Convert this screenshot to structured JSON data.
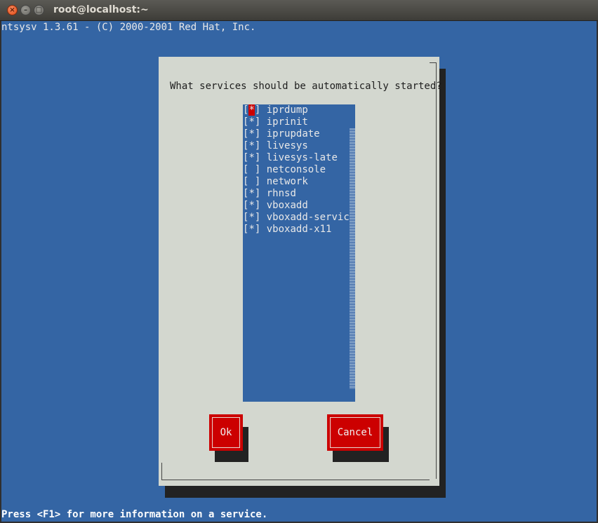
{
  "window": {
    "title": "root@localhost:~",
    "close_glyph": "×",
    "minimize_glyph": "–",
    "maximize_glyph": "□"
  },
  "terminal": {
    "header": "ntsysv 1.3.61 - (C) 2000-2001 Red Hat, Inc.",
    "footer": "Press <F1> for more information on a service."
  },
  "dialog": {
    "question": "What services should be automatically started?",
    "services": [
      {
        "name": "iprdump",
        "checked": true,
        "mark": "*"
      },
      {
        "name": "iprinit",
        "checked": true,
        "mark": "*"
      },
      {
        "name": "iprupdate",
        "checked": true,
        "mark": "*"
      },
      {
        "name": "livesys",
        "checked": true,
        "mark": "*"
      },
      {
        "name": "livesys-late",
        "checked": true,
        "mark": "*"
      },
      {
        "name": "netconsole",
        "checked": false,
        "mark": " "
      },
      {
        "name": "network",
        "checked": false,
        "mark": " "
      },
      {
        "name": "rhnsd",
        "checked": true,
        "mark": "*"
      },
      {
        "name": "vboxadd",
        "checked": true,
        "mark": "*"
      },
      {
        "name": "vboxadd-service",
        "checked": true,
        "mark": "*"
      },
      {
        "name": "vboxadd-x11",
        "checked": true,
        "mark": "*"
      }
    ],
    "ok_label": "Ok",
    "cancel_label": "Cancel"
  },
  "colors": {
    "terminal_bg": "#3465a4",
    "dialog_bg": "#d3d7cf",
    "button_bg": "#cc0000",
    "cursor_bg": "#cc0000"
  }
}
